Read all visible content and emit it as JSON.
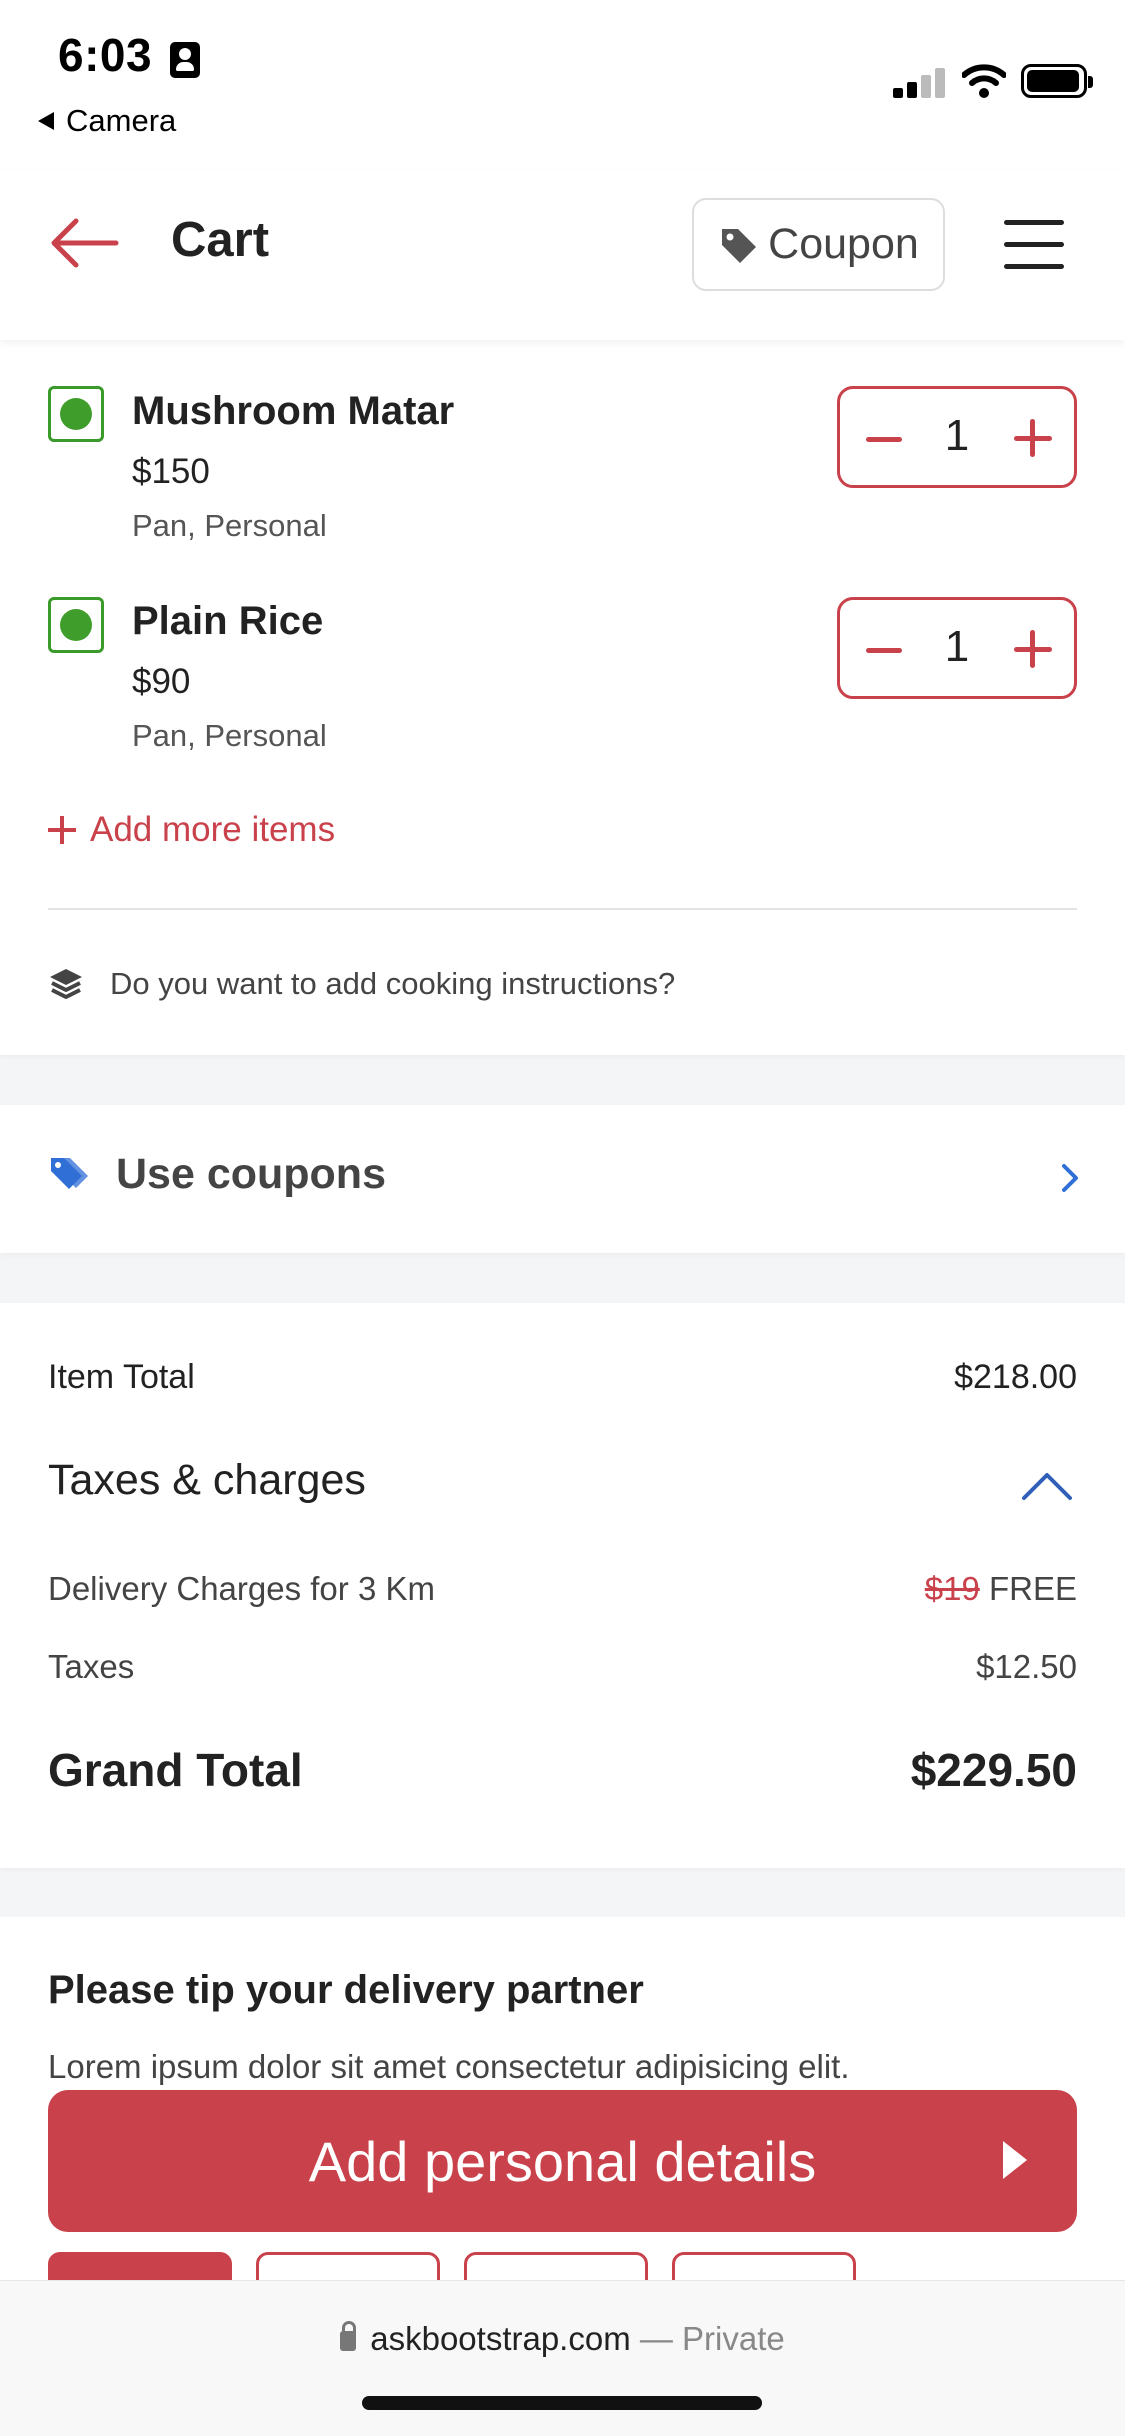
{
  "status": {
    "time": "6:03",
    "back_label": "Camera"
  },
  "header": {
    "title": "Cart",
    "coupon_label": "Coupon"
  },
  "items": [
    {
      "name": "Mushroom Matar",
      "price": "$150",
      "desc": "Pan, Personal",
      "qty": "1"
    },
    {
      "name": "Plain Rice",
      "price": "$90",
      "desc": "Pan, Personal",
      "qty": "1"
    }
  ],
  "add_more_label": "Add more items",
  "cooking_label": "Do you want to add cooking instructions?",
  "use_coupons_label": "Use coupons",
  "totals": {
    "item_total_label": "Item Total",
    "item_total_value": "$218.00",
    "taxes_charges_label": "Taxes & charges",
    "delivery_label": "Delivery Charges for 3 Km",
    "delivery_old": "$19",
    "delivery_new": "FREE",
    "taxes_label": "Taxes",
    "taxes_value": "$12.50",
    "grand_total_label": "Grand Total",
    "grand_total_value": "$229.50"
  },
  "tip": {
    "title": "Please tip your delivery partner",
    "text": "Lorem ipsum dolor sit amet consectetur adipisicing elit."
  },
  "cta_label": "Add personal details",
  "browser": {
    "domain": "askbootstrap.com",
    "separator": " — ",
    "mode": "Private"
  },
  "colors": {
    "accent": "#c9414a",
    "veg": "#3f9e2b",
    "link_blue": "#2f6fd6"
  }
}
